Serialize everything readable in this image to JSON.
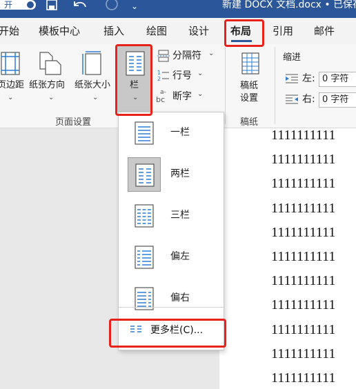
{
  "titlebar": {
    "toggle_label": "开",
    "doc_title": "新建 DOCX 文档.docx • 已保存"
  },
  "tabs": [
    {
      "label": "开始"
    },
    {
      "label": "模板中心"
    },
    {
      "label": "插入"
    },
    {
      "label": "绘图"
    },
    {
      "label": "设计"
    },
    {
      "label": "布局",
      "active": true
    },
    {
      "label": "引用"
    },
    {
      "label": "邮件"
    }
  ],
  "ribbon": {
    "margins_label": "页边距",
    "orientation_label": "纸张方向",
    "size_label": "纸张大小",
    "columns_label": "栏",
    "breaks_label": "分隔符",
    "line_numbers_label": "行号",
    "hyphenation_label": "断字",
    "page_setup_group": "页面设置",
    "manuscript_label_line1": "稿纸",
    "manuscript_label_line2": "设置",
    "manuscript_group": "稿纸",
    "indent_title": "缩进",
    "indent_left_label": "左:",
    "indent_left_value": "0 字符",
    "indent_right_label": "右:",
    "indent_right_value": "0 字符"
  },
  "columns_menu": {
    "items": [
      {
        "label": "一栏",
        "icon": "one-column-icon"
      },
      {
        "label": "两栏",
        "icon": "two-columns-icon",
        "selected": true
      },
      {
        "label": "三栏",
        "icon": "three-columns-icon"
      },
      {
        "label": "偏左",
        "icon": "left-column-icon"
      },
      {
        "label": "偏右",
        "icon": "right-column-icon"
      }
    ],
    "more_label": "更多栏(C)..."
  },
  "document": {
    "lines": [
      "1111111111",
      "1111111111",
      "1111111111",
      "1111111111",
      "1111111111",
      "1111111111",
      "1111111111",
      "1111111111",
      "1111111111",
      "1111111111",
      "1111111111"
    ]
  },
  "colors": {
    "title_bar": "#2b579a",
    "accent": "#2b7cd3",
    "highlight_box": "#e8221b"
  }
}
